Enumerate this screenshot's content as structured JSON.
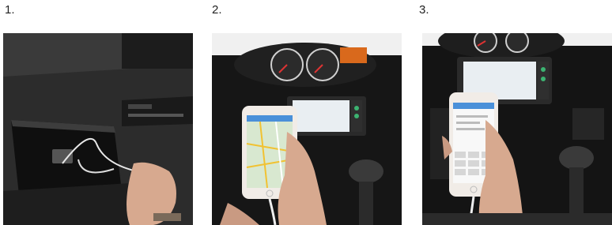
{
  "steps": [
    {
      "number": "1.",
      "photo_icon": "car-glovebox-usb-cable-photo"
    },
    {
      "number": "2.",
      "photo_icon": "iphone-map-app-in-car-photo"
    },
    {
      "number": "3.",
      "photo_icon": "iphone-keypad-app-in-car-photo"
    }
  ],
  "colors": {
    "dashboard": "#1a1a1a",
    "screen": "#e9eef2",
    "phone_body": "#f1ece7",
    "skin": "#d7a98f"
  }
}
